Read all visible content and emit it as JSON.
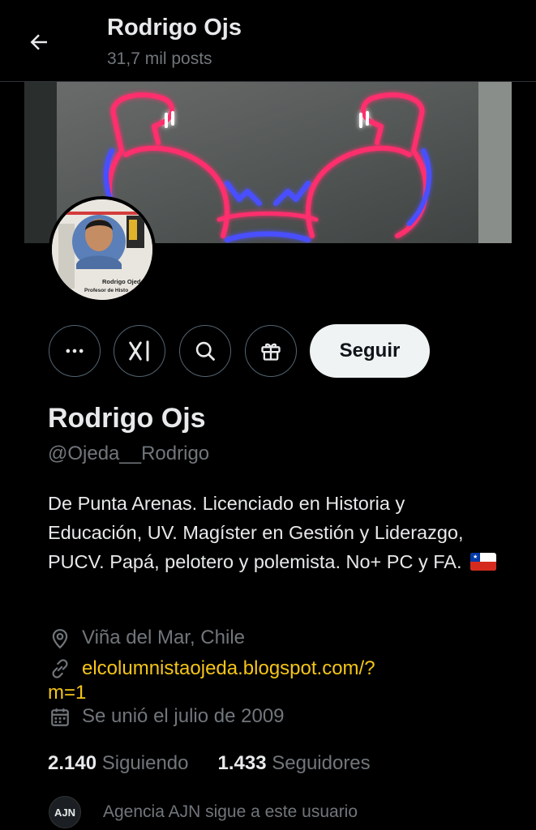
{
  "header": {
    "title": "Rodrigo Ojs",
    "posts": "31,7 mil posts"
  },
  "actions": {
    "follow_label": "Seguir"
  },
  "avatar": {
    "caption_name": "Rodrigo Ojeda",
    "caption_role": "Profesor de Histo"
  },
  "profile": {
    "name": "Rodrigo Ojs",
    "handle": "@Ojeda__Rodrigo",
    "bio": "De Punta Arenas. Licenciado en Historia y Educación, UV. Magíster en Gestión y Liderazgo, PUCV. Papá, pelotero y polemista. No+ PC y FA.",
    "location": "Viña del Mar, Chile",
    "website_line1": "elcolumnistaojeda.blogspot.com/?",
    "website_line2": "m=1",
    "joined": "Se unió el julio de 2009"
  },
  "stats": {
    "following_count": "2.140",
    "following_label": "Siguiendo",
    "followers_count": "1.433",
    "followers_label": "Seguidores"
  },
  "followed_by": {
    "avatar_text": "AJN",
    "text": "Agencia AJN sigue a este usuario"
  },
  "colors": {
    "link": "#f5c518",
    "muted": "#71767b",
    "neon_pink": "#ff2f6d",
    "neon_blue": "#3b3bff"
  }
}
